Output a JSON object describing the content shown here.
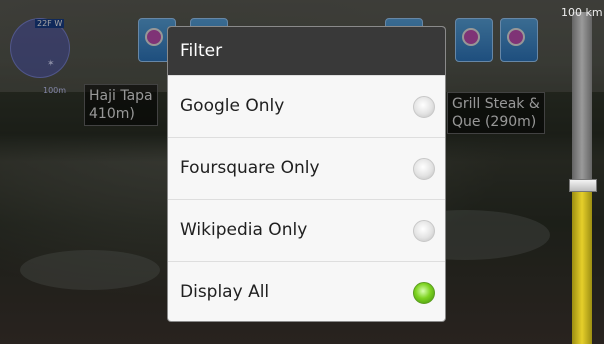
{
  "statusbar": {
    "badge": "22F W"
  },
  "radar": {
    "distance": "100m"
  },
  "slider": {
    "label": "100 km",
    "fill_fraction": 0.46
  },
  "poi_labels": [
    {
      "text": "Haji Tapa",
      "subtext": "410m)"
    },
    {
      "text": "Grill Steak &",
      "subtext": "Que (290m)"
    }
  ],
  "dialog": {
    "title": "Filter",
    "options": [
      {
        "label": "Google Only",
        "selected": false
      },
      {
        "label": "Foursquare Only",
        "selected": false
      },
      {
        "label": "Wikipedia Only",
        "selected": false
      },
      {
        "label": "Display All",
        "selected": true
      }
    ]
  },
  "colors": {
    "selected_radio": "#7ed321",
    "header": "#393939",
    "slider_fill": "#e6cf2a"
  }
}
